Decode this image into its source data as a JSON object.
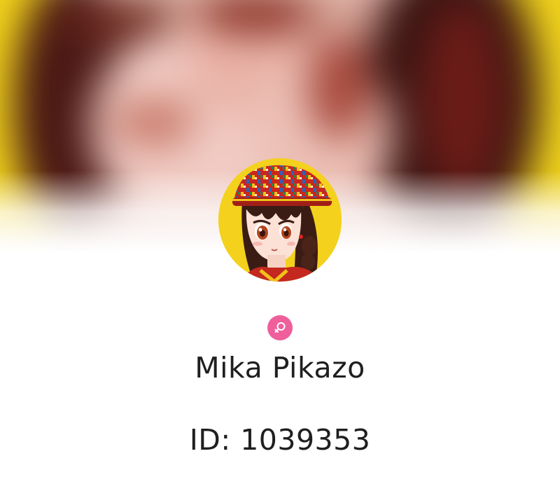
{
  "profile": {
    "banner_image": "blurred-cover-artwork",
    "avatar_image": "anime-girl-avatar",
    "gender_icon": "female-icon",
    "name": "Mika Pikazo",
    "id_label": "ID: 1039353"
  },
  "colors": {
    "background": "#ffffff",
    "gender_badge": "#ee5f9c",
    "text": "#1f1f1f",
    "banner_yellow": "#f3d51a",
    "banner_dark": "#3a1412"
  }
}
